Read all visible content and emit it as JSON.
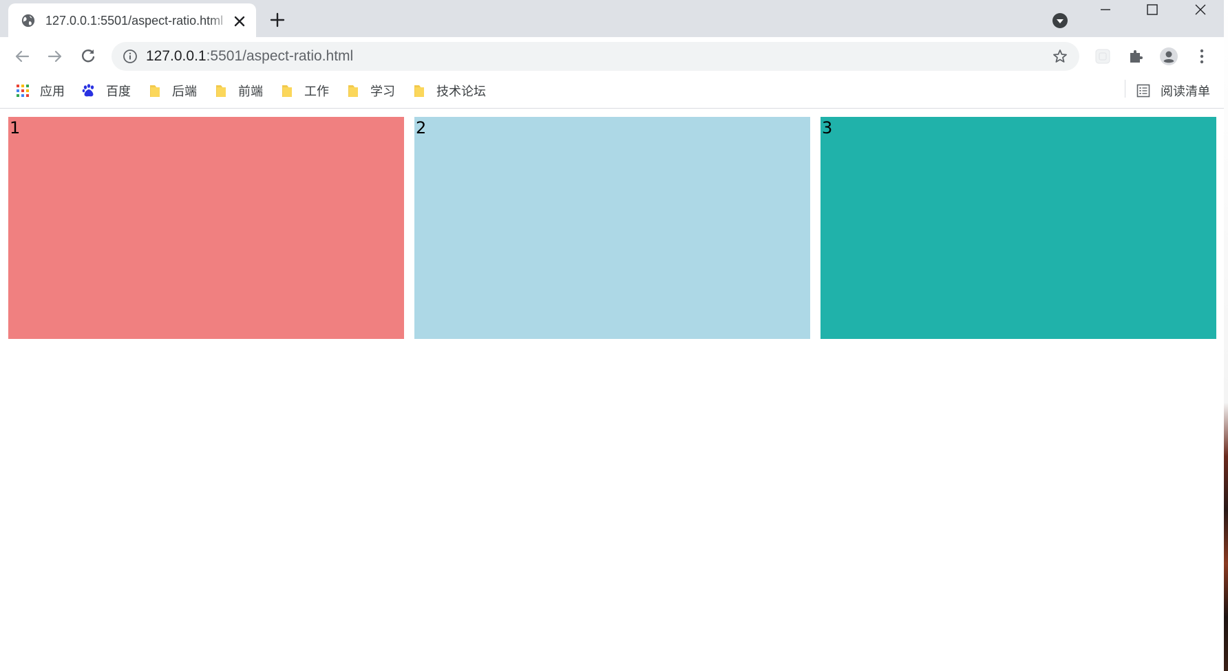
{
  "browser": {
    "tab": {
      "title": "127.0.0.1:5501/aspect-ratio.html",
      "favicon": "globe-icon"
    },
    "address": {
      "host": "127.0.0.1",
      "rest": ":5501/aspect-ratio.html"
    },
    "bookmarks": [
      {
        "label": "应用",
        "icon": "apps-grid-icon"
      },
      {
        "label": "百度",
        "icon": "baidu-paw-icon"
      },
      {
        "label": "后端",
        "icon": "folder-icon"
      },
      {
        "label": "前端",
        "icon": "folder-icon"
      },
      {
        "label": "工作",
        "icon": "folder-icon"
      },
      {
        "label": "学习",
        "icon": "folder-icon"
      },
      {
        "label": "技术论坛",
        "icon": "folder-icon"
      }
    ],
    "reading_list": {
      "label": "阅读清单",
      "icon": "reading-list-icon"
    }
  },
  "page": {
    "boxes": [
      {
        "label": "1",
        "color": "#f08080"
      },
      {
        "label": "2",
        "color": "#add8e6"
      },
      {
        "label": "3",
        "color": "#20b2aa"
      }
    ]
  },
  "colors": {
    "tabstrip": "#dee1e6",
    "omnibox": "#f1f3f4",
    "folder": "#fbd75b"
  }
}
